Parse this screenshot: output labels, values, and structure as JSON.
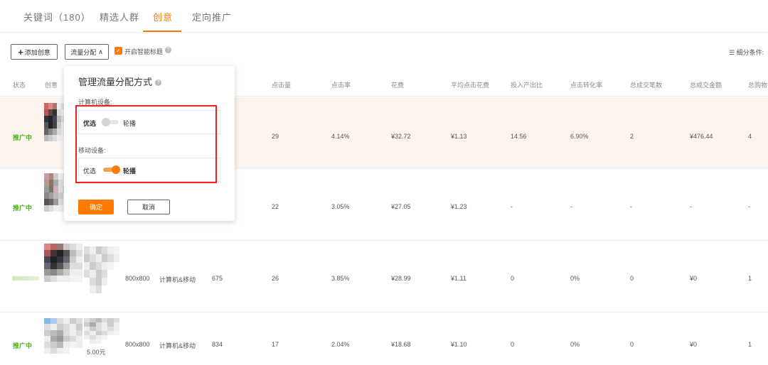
{
  "tabs": [
    {
      "label": "关键词（180）",
      "active": false
    },
    {
      "label": "精选人群",
      "active": false
    },
    {
      "label": "创意",
      "active": true
    },
    {
      "label": "定向推广",
      "active": false
    }
  ],
  "toolbar": {
    "add_label": "添加创意",
    "flow_label": "流量分配",
    "smart_title_label": "开启智能标题",
    "smart_title_checked": true,
    "filter_label": "细分条件:"
  },
  "columns": [
    "状态",
    "创意",
    "点击量",
    "点击率",
    "花费",
    "平均点击花费",
    "投入产出比",
    "点击转化率",
    "总成交笔数",
    "总成交金额",
    "总购物"
  ],
  "rows": [
    {
      "status": "推广中",
      "size": "",
      "device": "",
      "impressions": "",
      "clicks": "29",
      "ctr": "4.14%",
      "cost": "¥32.72",
      "cpc": "¥1.13",
      "roi": "14.56",
      "cvr": "6.90%",
      "orders": "2",
      "amount": "¥476.44",
      "cart": "4"
    },
    {
      "status": "推广中",
      "size": "",
      "device": "",
      "impressions": "",
      "clicks": "22",
      "ctr": "3.05%",
      "cost": "¥27.05",
      "cpc": "¥1.23",
      "roi": "-",
      "cvr": "-",
      "orders": "-",
      "amount": "-",
      "cart": "-"
    },
    {
      "status": "",
      "size": "800x800",
      "device": "计算机&移动",
      "impressions": "675",
      "clicks": "26",
      "ctr": "3.85%",
      "cost": "¥28.99",
      "cpc": "¥1.11",
      "roi": "0",
      "cvr": "0%",
      "orders": "0",
      "amount": "¥0",
      "cart": "1"
    },
    {
      "status": "推广中",
      "size": "800x800",
      "device": "计算机&移动",
      "impressions": "834",
      "clicks": "17",
      "ctr": "2.04%",
      "cost": "¥18.68",
      "cpc": "¥1.10",
      "roi": "0",
      "cvr": "0%",
      "orders": "0",
      "amount": "¥0",
      "cart": "1",
      "price": "5.00元"
    }
  ],
  "popup": {
    "title": "管理流量分配方式",
    "pc_label": "计算机设备:",
    "mobile_label": "移动设备:",
    "option_preferred": "优选",
    "option_rotate": "轮播",
    "pc_mode": "preferred",
    "mobile_mode": "rotate",
    "confirm_label": "确定",
    "cancel_label": "取消"
  },
  "colors": {
    "accent": "#ff7a00",
    "status_active": "#4caf1e",
    "highlight_row": "#fdf4ee",
    "annotation_red": "#e22222"
  }
}
